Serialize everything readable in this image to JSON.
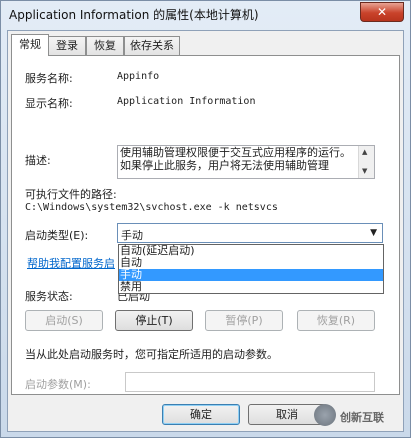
{
  "window": {
    "title": "Application Information 的属性(本地计算机)",
    "close_glyph": "✕"
  },
  "tabs": [
    {
      "label": "常规"
    },
    {
      "label": "登录"
    },
    {
      "label": "恢复"
    },
    {
      "label": "依存关系"
    }
  ],
  "general": {
    "service_name_label": "服务名称:",
    "service_name_value": "Appinfo",
    "display_name_label": "显示名称:",
    "display_name_value": "Application Information",
    "description_label": "描述:",
    "description_value": "使用辅助管理权限便于交互式应用程序的运行。如果停止此服务，用户将无法使用辅助管理",
    "exe_path_label": "可执行文件的路径:",
    "exe_path_value": "C:\\Windows\\system32\\svchost.exe -k netsvcs",
    "startup_type_label": "启动类型(E):",
    "startup_type_value": "手动",
    "startup_options": [
      "自动(延迟启动)",
      "自动",
      "手动",
      "禁用"
    ],
    "selected_option_index": 2,
    "help_link": "帮助我配置服务启",
    "service_status_label": "服务状态:",
    "service_status_value": "已启动",
    "buttons": {
      "start": "启动(S)",
      "stop": "停止(T)",
      "pause": "暂停(P)",
      "resume": "恢复(R)"
    },
    "start_params_hint": "当从此处启动服务时，您可指定所适用的启动参数。",
    "start_params_label": "启动参数(M):",
    "start_params_value": ""
  },
  "dialog_buttons": {
    "ok": "确定",
    "cancel": "取消"
  },
  "watermark": {
    "text": "创新互联"
  },
  "colors": {
    "selection": "#3399ff",
    "link": "#0066cc"
  }
}
